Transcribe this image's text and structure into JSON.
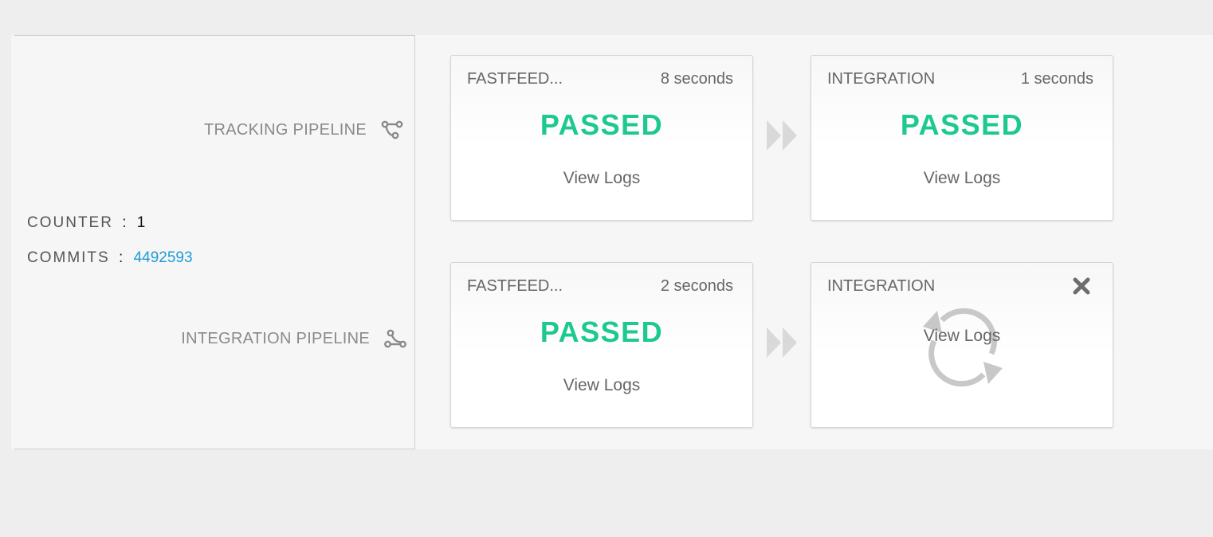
{
  "info": {
    "counter_label": "COUNTER",
    "counter_sep": ":",
    "counter_value": "1",
    "commits_label": "COMMITS",
    "commits_sep": ":",
    "commits_value": "4492593"
  },
  "pipelines": [
    {
      "label": "TRACKING PIPELINE",
      "icon": "tracking-pipeline-icon",
      "stages": [
        {
          "name": "FASTFEED...",
          "duration": "8 seconds",
          "status": "PASSED",
          "logs_label": "View Logs"
        },
        {
          "name": "INTEGRATION",
          "duration": "1 seconds",
          "status": "PASSED",
          "logs_label": "View Logs"
        }
      ]
    },
    {
      "label": "INTEGRATION PIPELINE",
      "icon": "integration-pipeline-icon",
      "stages": [
        {
          "name": "FASTFEED...",
          "duration": "2 seconds",
          "status": "PASSED",
          "logs_label": "View Logs"
        },
        {
          "name": "INTEGRATION",
          "status": "running",
          "logs_label": "View Logs",
          "action_icon": "close-icon",
          "status_icon": "refresh-spinner-icon"
        }
      ]
    }
  ],
  "colors": {
    "passed": "#1cc98f",
    "link": "#1e9bd7",
    "arrow": "#d9d9d9",
    "spinner": "#c8c8c8"
  }
}
